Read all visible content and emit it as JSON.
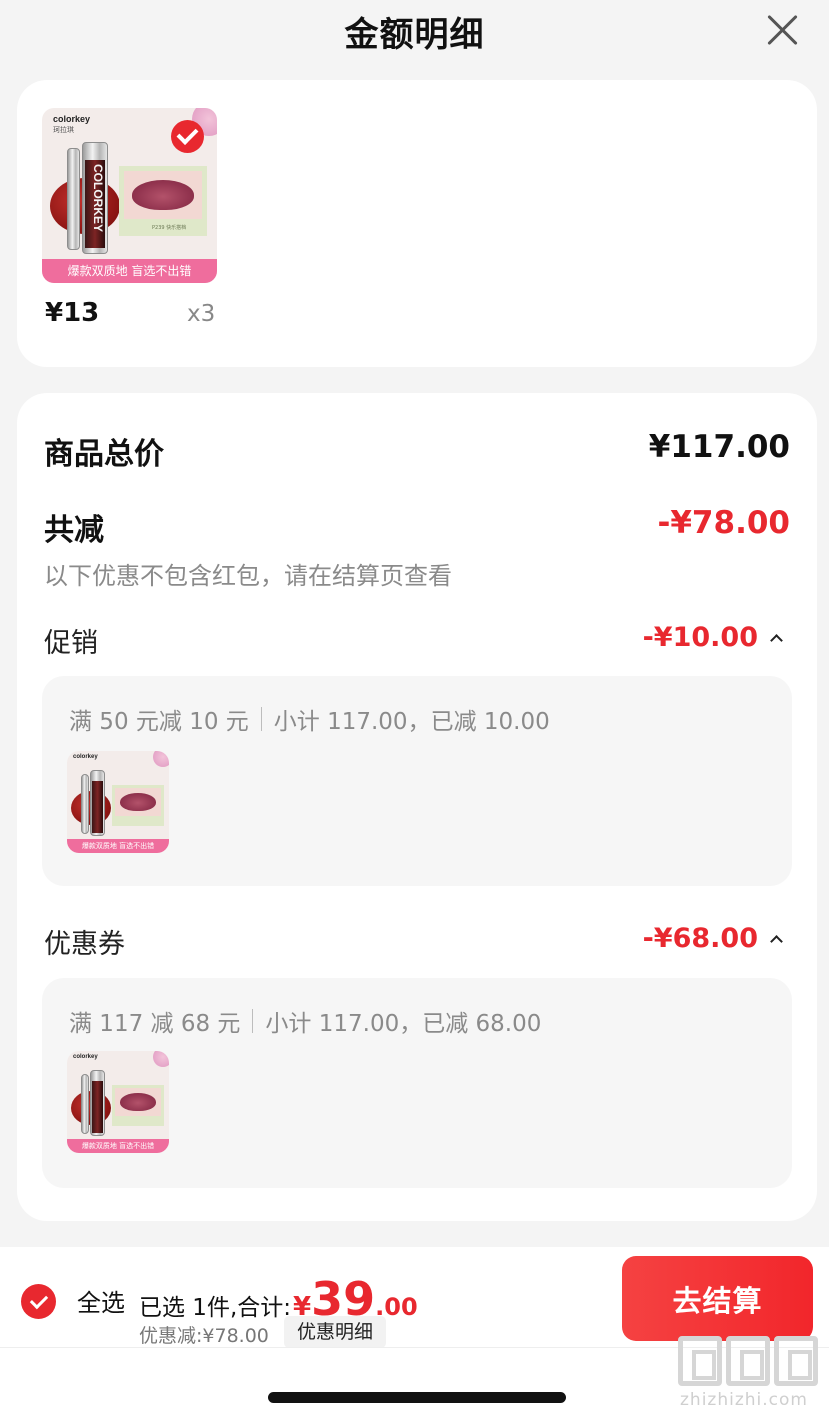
{
  "header": {
    "title": "金额明细"
  },
  "product": {
    "brand": "colorkey",
    "brand_cn": "珂拉琪",
    "tube_text": "COLORKEY",
    "banner": "爆款双质地 盲选不出错",
    "label": "P239 快乐搭档",
    "price": "¥13",
    "quantity": "x3"
  },
  "summary": {
    "total_label": "商品总价",
    "total_value": "¥117.00",
    "reduce_label": "共减",
    "reduce_value": "-¥78.00",
    "note": "以下优惠不包含红包，请在结算页查看"
  },
  "promotion": {
    "label": "促销",
    "value": "-¥10.00",
    "rule": "满 50 元减 10 元",
    "detail": "小计 117.00，已减 10.00"
  },
  "coupon": {
    "label": "优惠券",
    "value": "-¥68.00",
    "rule": "满 117 减 68 元",
    "detail": "小计 117.00，已减 68.00"
  },
  "bottom_bar": {
    "select_all": "全选",
    "selected_text": "已选 1件,合计:",
    "currency": "¥",
    "total_int": "39",
    "total_dec": ".00",
    "discount": "优惠减:¥78.00",
    "detail_button": "优惠明细",
    "checkout_button": "去结算"
  },
  "watermark": {
    "text": "zhizhizhi.com"
  },
  "colors": {
    "accent_red": "#e8282f",
    "banner_pink": "#ef6d9d"
  }
}
